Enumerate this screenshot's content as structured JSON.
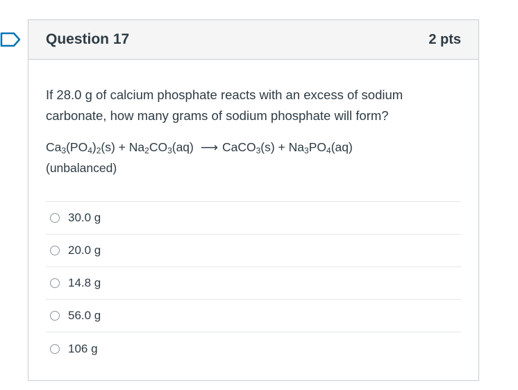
{
  "question": {
    "title": "Question 17",
    "points": "2 pts",
    "prompt": "If 28.0 g of calcium phosphate reacts with an excess of sodium carbonate, how many grams of sodium phosphate will form?",
    "equation": {
      "reactant1": [
        "Ca",
        "3",
        "(PO",
        "4",
        ")",
        "2",
        "(s)"
      ],
      "plus1": " + ",
      "reactant2": [
        "Na",
        "2",
        "CO",
        "3",
        "(aq)"
      ],
      "arrow": "⟶",
      "product1": [
        "CaCO",
        "3",
        "(s)"
      ],
      "plus2": " + ",
      "product2": [
        "Na",
        "3",
        "PO",
        "4",
        "(aq)"
      ],
      "note": "(unbalanced)"
    },
    "answers": [
      "30.0 g",
      "20.0 g",
      "14.8 g",
      "56.0 g",
      "106 g"
    ]
  },
  "colors": {
    "flag": "#0374b5",
    "border": "#c7cdd1",
    "header_bg": "#f5f5f5",
    "text": "#2d3b45"
  },
  "icons": {
    "flag": "bookmark-flag-icon",
    "radio": "radio-unselected-icon"
  }
}
